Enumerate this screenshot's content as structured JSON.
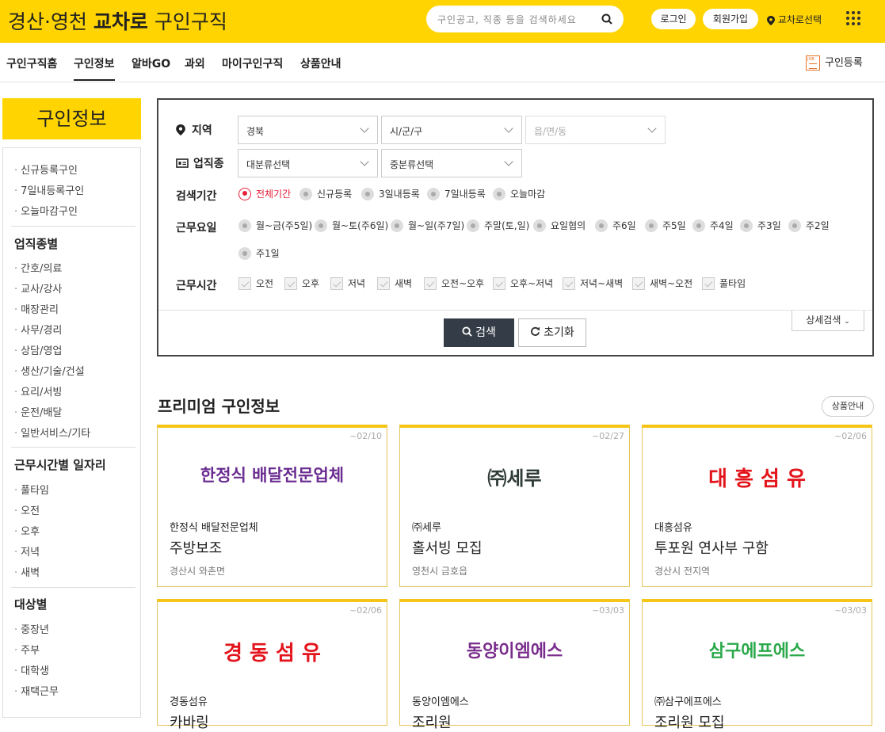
{
  "header": {
    "brand_region": "경산·영천",
    "brand_name": "교차로",
    "brand_suffix": "구인구직",
    "search_placeholder": "구인공고, 직종 등을 검색하세요",
    "login": "로그인",
    "signup": "회원가입",
    "location": "교차로선택",
    "brand_color": "#ffd400"
  },
  "nav": {
    "items": [
      "구인구직홈",
      "구인정보",
      "알바GO",
      "과외",
      "마이구인구직",
      "상품안내"
    ],
    "active_index": 1,
    "register": "구인등록"
  },
  "sidebar": {
    "title": "구인정보",
    "quick": [
      "신규등록구인",
      "7일내등록구인",
      "오늘마감구인"
    ],
    "sections": [
      {
        "title": "업직종별",
        "items": [
          "간호/의료",
          "교사/강사",
          "매장관리",
          "사무/경리",
          "상담/영업",
          "생산/기술/건설",
          "요리/서빙",
          "운전/배달",
          "일반서비스/기타"
        ]
      },
      {
        "title": "근무시간별 일자리",
        "items": [
          "풀타임",
          "오전",
          "오후",
          "저녁",
          "새벽"
        ]
      },
      {
        "title": "대상별",
        "items": [
          "중장년",
          "주부",
          "대학생",
          "재택근무"
        ]
      }
    ]
  },
  "filter": {
    "region_label": "지역",
    "region_selects": [
      "경북",
      "시/군/구",
      "읍/면/동"
    ],
    "job_label": "업직종",
    "job_selects": [
      "대분류선택",
      "중분류선택"
    ],
    "period_label": "검색기간",
    "period_options": [
      "전체기간",
      "신규등록",
      "3일내등록",
      "7일내등록",
      "오늘마감"
    ],
    "period_selected": "전체기간",
    "days_label": "근무요일",
    "days_options": [
      "월~금(주5일)",
      "월~토(주6일)",
      "월~일(주7일)",
      "주말(토,일)",
      "요일협의",
      "주6일",
      "주5일",
      "주4일",
      "주3일",
      "주2일",
      "주1일"
    ],
    "hours_label": "근무시간",
    "hours_options": [
      "오전",
      "오후",
      "저녁",
      "새벽",
      "오전~오후",
      "오후~저녁",
      "저녁~새벽",
      "새벽~오전",
      "풀타임"
    ],
    "search_button": "검색",
    "reset_button": "초기화",
    "detail_button": "상세검색"
  },
  "premium": {
    "title": "프리미엄 구인정보",
    "guide_button": "상품안내",
    "cards": [
      {
        "due": "~02/10",
        "logo": "한정식 배달전문업체",
        "logo_color": "#6a2c91",
        "company": "한정식 배달전문업체",
        "job": "주방보조",
        "area": "경산시 와촌면"
      },
      {
        "due": "~02/27",
        "logo": "㈜세루",
        "logo_color": "#2e3b36",
        "company": "㈜세루",
        "job": "홀서빙 모집",
        "area": "영천시 금호읍"
      },
      {
        "due": "~02/06",
        "logo": "대 흥 섬 유",
        "logo_color": "#e3141b",
        "company": "대흥섬유",
        "job": "투포원 연사부 구함",
        "area": "경산시 전지역"
      },
      {
        "due": "~02/06",
        "logo": "경 동 섬 유",
        "logo_color": "#e3141b",
        "company": "경동섬유",
        "job": "카바링",
        "area": ""
      },
      {
        "due": "~03/03",
        "logo": "동양이엠에스",
        "logo_color": "#7a2d8c",
        "company": "동양이엠에스",
        "job": "조리원",
        "area": ""
      },
      {
        "due": "~03/03",
        "logo": "삼구에프에스",
        "logo_color": "#2aa84a",
        "company": "㈜삼구에프에스",
        "job": "조리원 모집",
        "area": ""
      }
    ]
  }
}
